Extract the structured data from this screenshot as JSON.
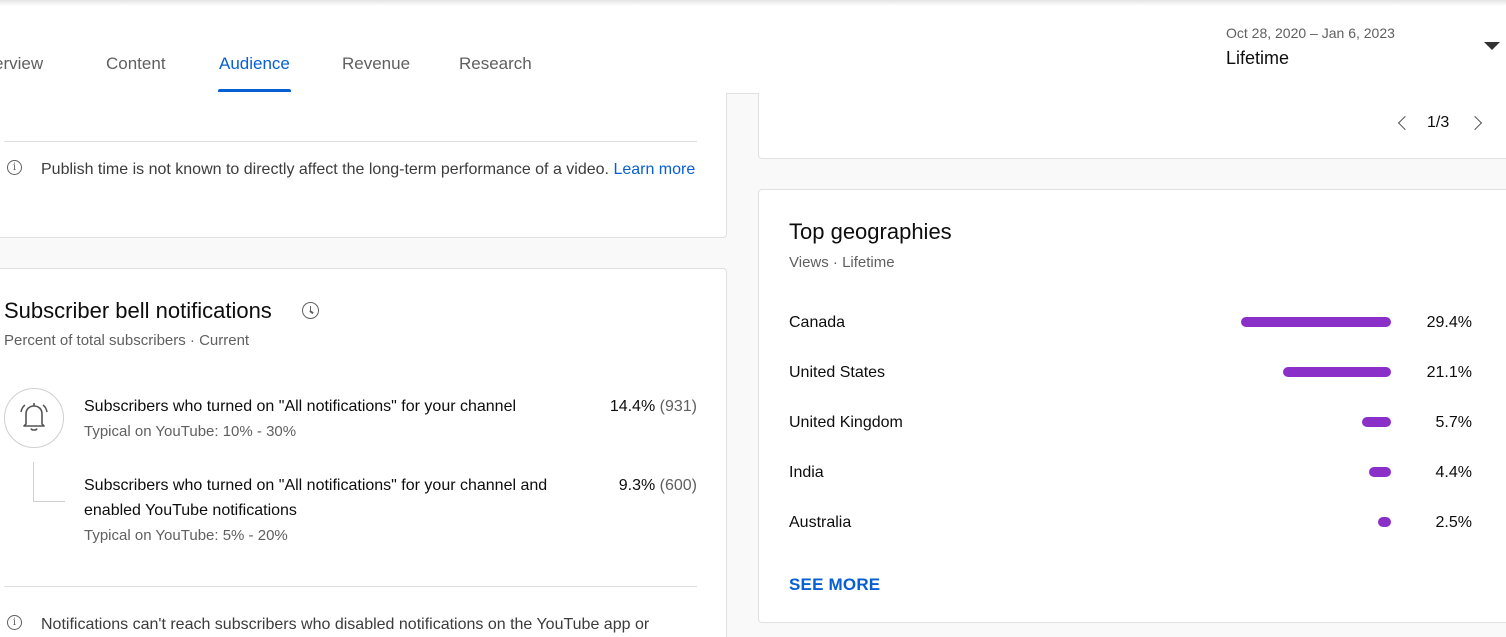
{
  "tabs": [
    {
      "label": "erview"
    },
    {
      "label": "Content"
    },
    {
      "label": "Audience"
    },
    {
      "label": "Revenue"
    },
    {
      "label": "Research"
    }
  ],
  "active_tab": "Audience",
  "date_range": {
    "range": "Oct 28, 2020 – Jan 6, 2023",
    "period": "Lifetime"
  },
  "publish_note": {
    "text": "Publish time is not known to directly affect the long-term performance of a video. ",
    "link": "Learn more"
  },
  "pager": {
    "text": "1/3"
  },
  "bell": {
    "title": "Subscriber bell notifications",
    "subtitle": "Percent of total subscribers · Current",
    "rows": [
      {
        "text": "Subscribers who turned on \"All notifications\" for your channel",
        "typical": "Typical on YouTube: 10% - 30%",
        "percent": "14.4%",
        "count": "(931)"
      },
      {
        "text": "Subscribers who turned on \"All notifications\" for your channel and enabled YouTube notifications",
        "typical": "Typical on YouTube: 5% - 20%",
        "percent": "9.3%",
        "count": "(600)"
      }
    ],
    "note": "Notifications can't reach subscribers who disabled notifications on the YouTube app or"
  },
  "geo": {
    "title": "Top geographies",
    "subtitle": "Views · Lifetime",
    "items": [
      {
        "name": "Canada",
        "value": "29.4%",
        "share": 29.4
      },
      {
        "name": "United States",
        "value": "21.1%",
        "share": 21.1
      },
      {
        "name": "United Kingdom",
        "value": "5.7%",
        "share": 5.7
      },
      {
        "name": "India",
        "value": "4.4%",
        "share": 4.4
      },
      {
        "name": "Australia",
        "value": "2.5%",
        "share": 2.5
      }
    ],
    "see_more": "SEE MORE"
  },
  "colors": {
    "accent": "#065fd4",
    "bar": "#8b2fc9"
  },
  "icons": [
    "info-icon",
    "clock-icon",
    "bell-icon",
    "chevron-left-icon",
    "chevron-right-icon",
    "dropdown-arrow-icon"
  ]
}
